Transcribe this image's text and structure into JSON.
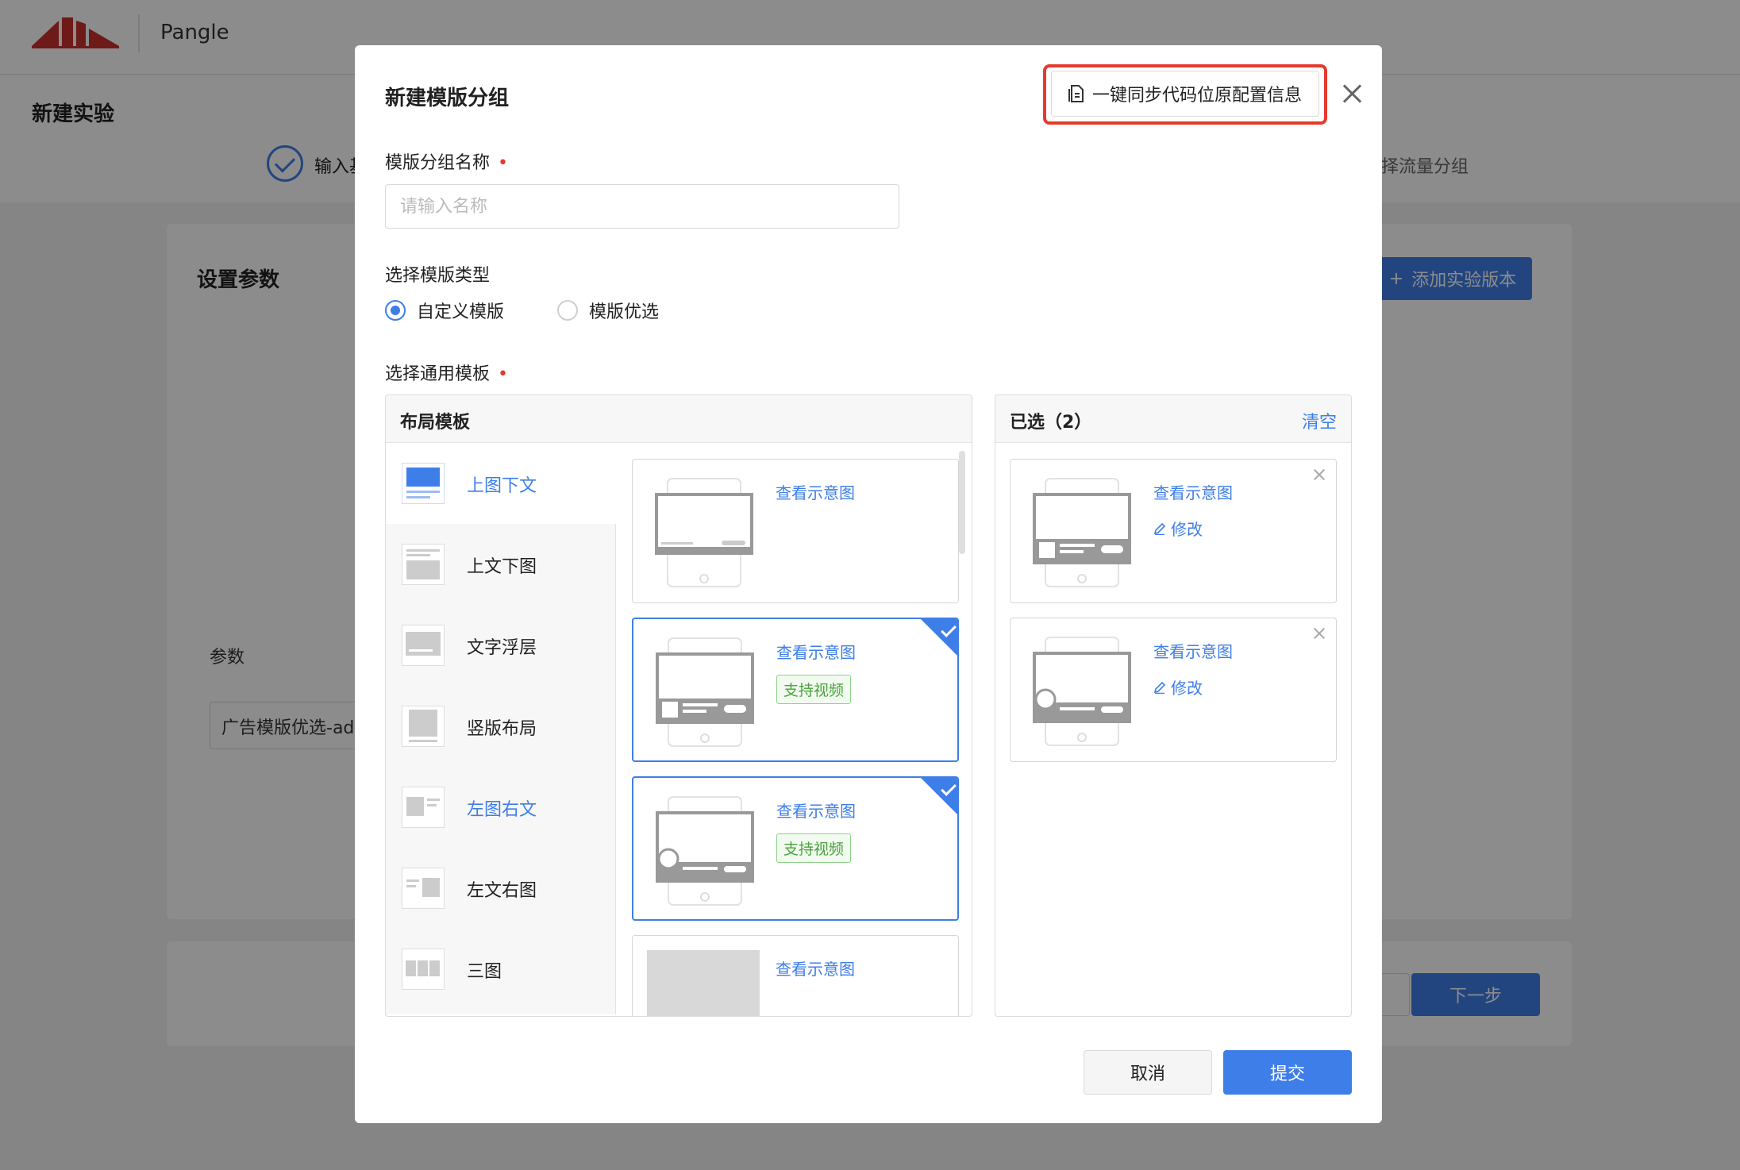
{
  "app": {
    "brand": "Pangle"
  },
  "page": {
    "title": "新建实验",
    "steps": [
      {
        "label": "输入基"
      },
      {
        "label": "择流量分组"
      }
    ],
    "card_title": "设置参数",
    "add_version_label": "添加实验版本",
    "param_label": "参数",
    "param_value": "广告模版优选-ad",
    "next_label": "下一步"
  },
  "modal": {
    "title": "新建模版分组",
    "sync_button": "一键同步代码位原配置信息",
    "name_label": "模版分组名称",
    "name_placeholder": "请输入名称",
    "type_label": "选择模版类型",
    "type_options": [
      {
        "label": "自定义模版",
        "selected": true
      },
      {
        "label": "模版优选",
        "selected": false
      }
    ],
    "template_label": "选择通用模板",
    "layout_panel": {
      "title": "布局模板",
      "layouts": [
        {
          "label": "上图下文",
          "active": true
        },
        {
          "label": "上文下图"
        },
        {
          "label": "文字浮层"
        },
        {
          "label": "竖版布局"
        },
        {
          "label": "左图右文"
        },
        {
          "label": "左文右图"
        },
        {
          "label": "三图"
        }
      ],
      "cards": [
        {
          "link": "查看示意图",
          "tag": "",
          "selected": false
        },
        {
          "link": "查看示意图",
          "tag": "支持视频",
          "selected": true
        },
        {
          "link": "查看示意图",
          "tag": "支持视频",
          "selected": true
        },
        {
          "link": "查看示意图",
          "tag": "",
          "selected": false
        }
      ]
    },
    "selected_panel": {
      "title": "已选（2）",
      "clear": "清空",
      "cards": [
        {
          "link": "查看示意图",
          "edit": "修改"
        },
        {
          "link": "查看示意图",
          "edit": "修改"
        }
      ]
    },
    "cancel": "取消",
    "submit": "提交"
  },
  "colors": {
    "accent": "#3e7ee8",
    "highlight": "#e53a2e",
    "tag_green": "#4aa33c"
  }
}
